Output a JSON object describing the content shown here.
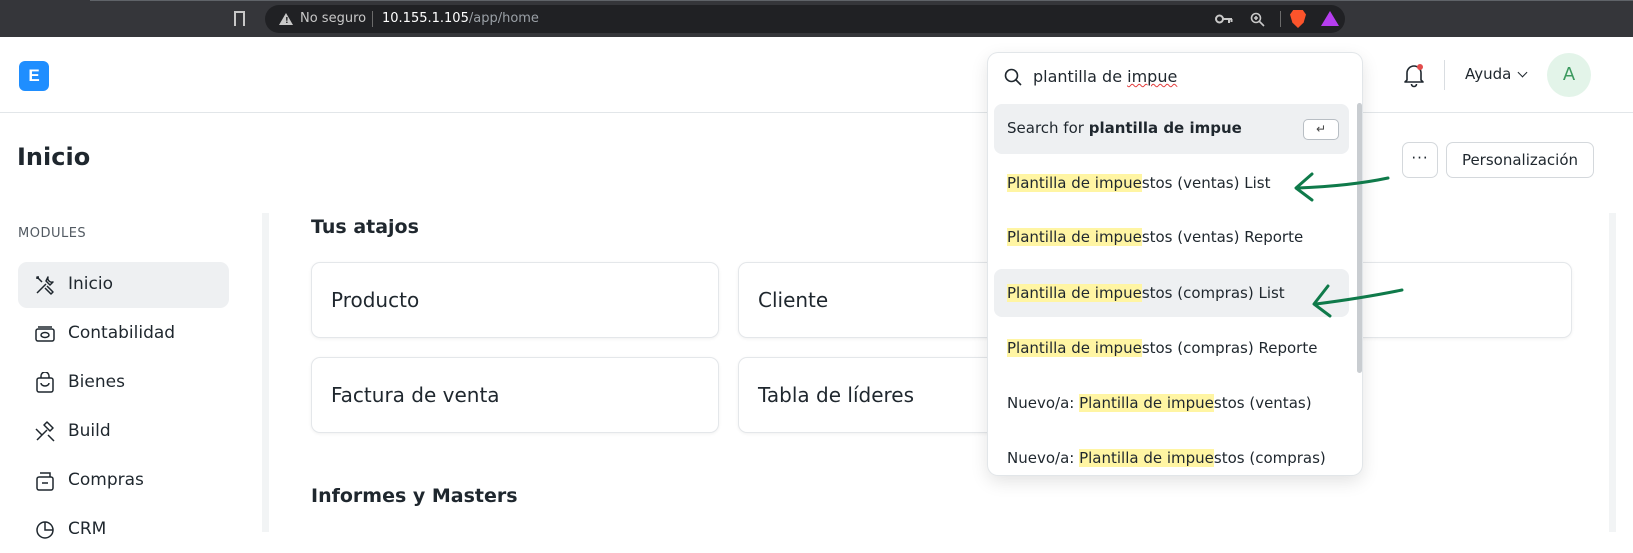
{
  "browser": {
    "security_label": "No seguro",
    "url_host": "10.155.1.105",
    "url_path": "/app/home"
  },
  "navbar": {
    "logo_letter": "E",
    "help_label": "Ayuda",
    "avatar_initial": "A"
  },
  "page": {
    "title": "Inicio",
    "more_label": "···",
    "customize_label": "Personalización"
  },
  "sidebar": {
    "section_label": "MODULES",
    "items": [
      {
        "label": "Inicio",
        "icon": "tools-icon",
        "active": true
      },
      {
        "label": "Contabilidad",
        "icon": "accounting-icon",
        "active": false
      },
      {
        "label": "Bienes",
        "icon": "box-icon",
        "active": false
      },
      {
        "label": "Build",
        "icon": "hammer-icon",
        "active": false
      },
      {
        "label": "Compras",
        "icon": "purchase-icon",
        "active": false
      },
      {
        "label": "CRM",
        "icon": "crm-icon",
        "active": false
      }
    ]
  },
  "main": {
    "shortcuts_title": "Tus atajos",
    "shortcuts": [
      "Producto",
      "Cliente",
      "Factura de venta",
      "Tabla de líderes"
    ],
    "reports_title": "Informes y Masters"
  },
  "search": {
    "query_plain": "plantilla de ",
    "query_squiggly": "impue",
    "search_for_prefix": "Search for ",
    "search_for_query": "plantilla de impue",
    "enter_key": "↵",
    "results": [
      {
        "prefix": "",
        "highlight": "Plantilla de impue",
        "suffix": "stos (ventas) List"
      },
      {
        "prefix": "",
        "highlight": "Plantilla de impue",
        "suffix": "stos (ventas) Reporte"
      },
      {
        "prefix": "",
        "highlight": "Plantilla de impue",
        "suffix": "stos (compras) List"
      },
      {
        "prefix": "",
        "highlight": "Plantilla de impue",
        "suffix": "stos (compras) Reporte"
      },
      {
        "prefix": "Nuevo/a: ",
        "highlight": "Plantilla de impue",
        "suffix": "stos (ventas)"
      },
      {
        "prefix": "Nuevo/a: ",
        "highlight": "Plantilla de impue",
        "suffix": "stos (compras)"
      }
    ]
  },
  "colors": {
    "accent": "#1f8eff",
    "highlight": "#fff5a3",
    "annotation_arrow": "#0f7a4a"
  }
}
